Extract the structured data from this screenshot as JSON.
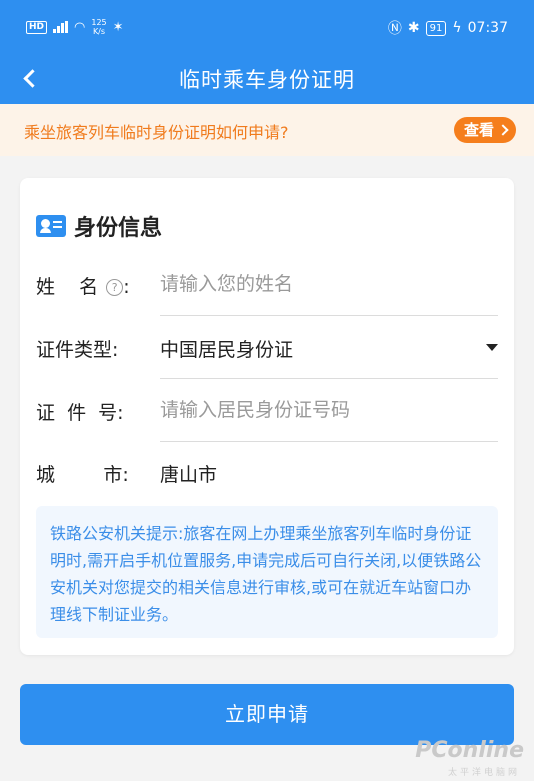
{
  "status_bar": {
    "hd": "HD",
    "network_speed": "125",
    "speed_unit": "K/s",
    "battery": "91",
    "time": "07:37"
  },
  "nav": {
    "title": "临时乘车身份证明"
  },
  "notice": {
    "text": "乘坐旅客列车临时身份证明如何申请?",
    "button": "查看"
  },
  "card": {
    "title": "身份信息",
    "fields": [
      {
        "label": "姓    名",
        "placeholder": "请输入您的姓名",
        "value": ""
      },
      {
        "label": "证件类型:",
        "value": "中国居民身份证"
      },
      {
        "label": "证  件  号:",
        "placeholder": "请输入居民身份证号码",
        "value": ""
      },
      {
        "label": "城        市:",
        "value": "唐山市"
      }
    ],
    "tip": "铁路公安机关提示:旅客在网上办理乘坐旅客列车临时身份证明时,需开启手机位置服务,申请完成后可自行关闭,以便铁路公安机关对您提交的相关信息进行审核,或可在就近车站窗口办理线下制证业务。"
  },
  "submit_label": "立即申请",
  "watermark": {
    "brand": "PConline",
    "sub": "太平洋电脑网"
  },
  "colors": {
    "primary": "#2e8ff0",
    "notice_bg": "#fdf3e8",
    "notice_text": "#f07b1d",
    "tip_bg": "#f1f7fe",
    "tip_text": "#3b8ee8"
  }
}
